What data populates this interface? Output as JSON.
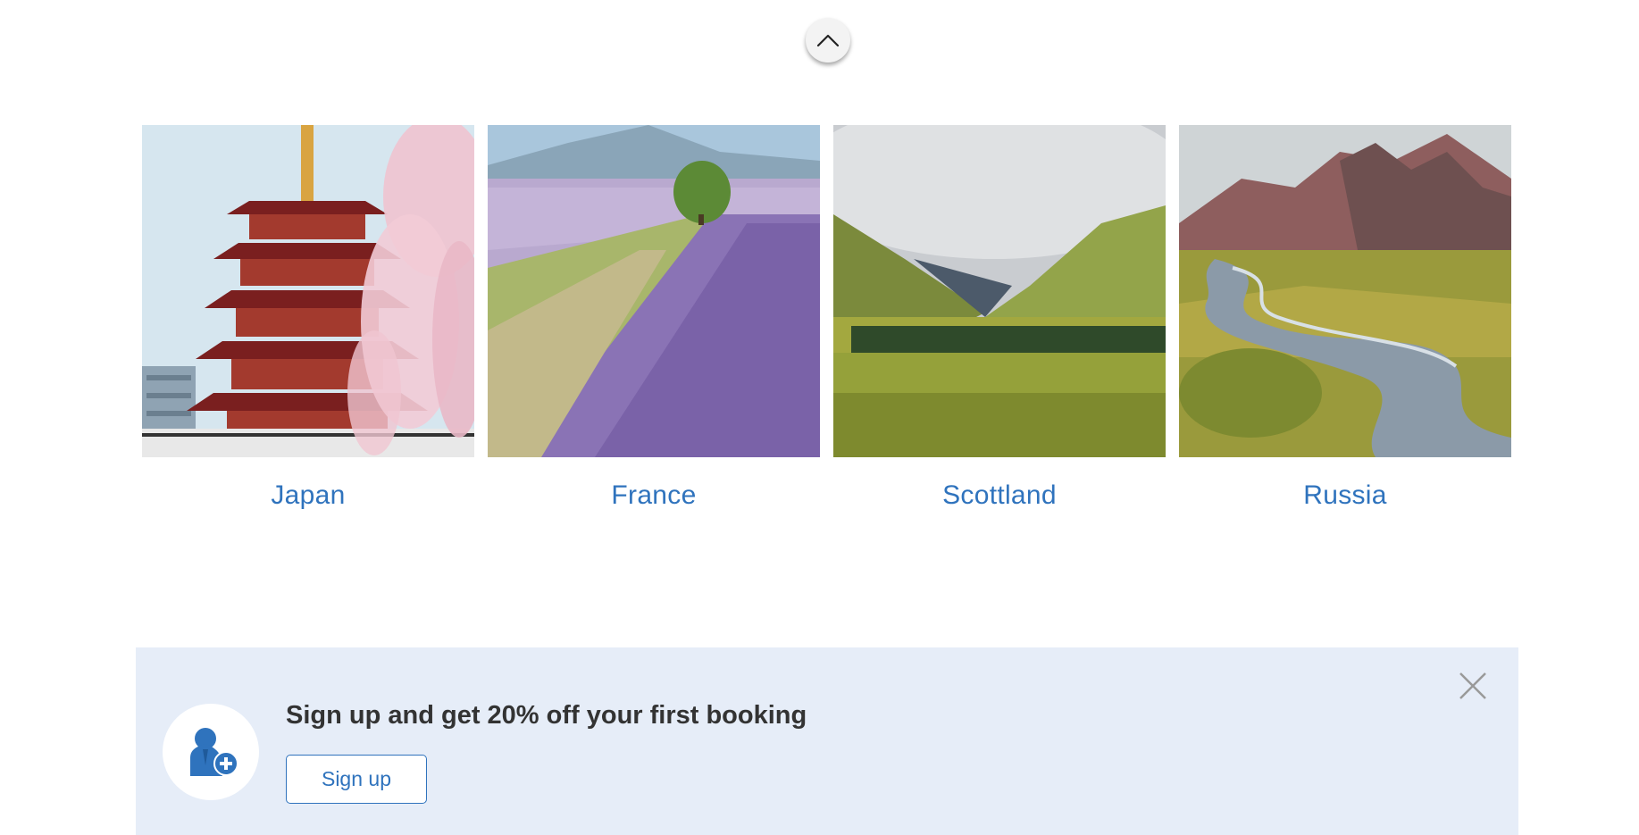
{
  "scroll_up_button": {
    "icon": "chevron-up-icon"
  },
  "destinations": [
    {
      "label": "Japan",
      "image": "pagoda-cherry-blossom-photo"
    },
    {
      "label": "France",
      "image": "lavender-field-photo"
    },
    {
      "label": "Scottland",
      "image": "highland-valley-photo"
    },
    {
      "label": "Russia",
      "image": "volcanic-stream-photo"
    }
  ],
  "signup_banner": {
    "heading": "Sign up and get 20% off your first booking",
    "button_label": "Sign up",
    "icon": "add-user-icon",
    "close_icon": "close-icon"
  },
  "colors": {
    "accent": "#2f73bd",
    "banner_background": "#e6edf8",
    "heading_text": "#333333"
  }
}
